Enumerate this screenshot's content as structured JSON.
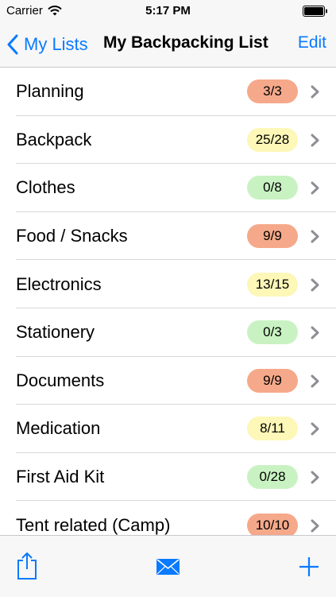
{
  "status": {
    "carrier": "Carrier",
    "time": "5:17 PM"
  },
  "nav": {
    "back_label": "My Lists",
    "title": "My Backpacking List",
    "edit_label": "Edit"
  },
  "colors": {
    "accent": "#0a7aff",
    "complete": "#f5a98a",
    "partial": "#fdf7b8",
    "empty": "#c9f2c2"
  },
  "list": {
    "items": [
      {
        "label": "Planning",
        "count": "3/3",
        "status": "complete"
      },
      {
        "label": "Backpack",
        "count": "25/28",
        "status": "partial"
      },
      {
        "label": "Clothes",
        "count": "0/8",
        "status": "empty"
      },
      {
        "label": "Food / Snacks",
        "count": "9/9",
        "status": "complete"
      },
      {
        "label": "Electronics",
        "count": "13/15",
        "status": "partial"
      },
      {
        "label": "Stationery",
        "count": "0/3",
        "status": "empty"
      },
      {
        "label": "Documents",
        "count": "9/9",
        "status": "complete"
      },
      {
        "label": "Medication",
        "count": "8/11",
        "status": "partial"
      },
      {
        "label": "First Aid Kit",
        "count": "0/28",
        "status": "empty"
      },
      {
        "label": "Tent related (Camp)",
        "count": "10/10",
        "status": "complete"
      }
    ]
  },
  "toolbar": {
    "icons": [
      "share-icon",
      "mail-icon",
      "add-icon"
    ]
  }
}
